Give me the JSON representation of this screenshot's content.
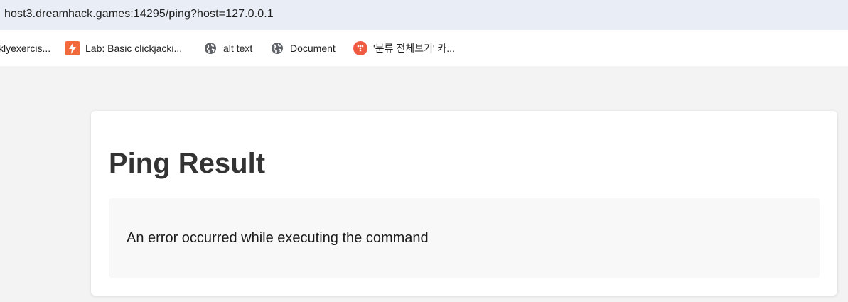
{
  "browser": {
    "url": "host3.dreamhack.games:14295/ping?host=127.0.0.1"
  },
  "bookmarks": [
    {
      "label": "klyexercis...",
      "icon": "none"
    },
    {
      "label": "Lab: Basic clickjacki...",
      "icon": "portswigger-lab-icon"
    },
    {
      "label": "alt text",
      "icon": "globe-icon"
    },
    {
      "label": "Document",
      "icon": "globe-icon"
    },
    {
      "label": "'분류 전체보기' 카...",
      "icon": "tistory-icon"
    }
  ],
  "main": {
    "title": "Ping Result",
    "message": "An error occurred while executing the command"
  },
  "colors": {
    "addressbar_bg": "#e9eef6",
    "page_bg": "#f3f3f3",
    "card_bg": "#ffffff",
    "result_bg": "#f8f8f8",
    "title_color": "#333333",
    "lab_icon": "#f26a3b",
    "tistory_icon": "#ef5a43"
  }
}
